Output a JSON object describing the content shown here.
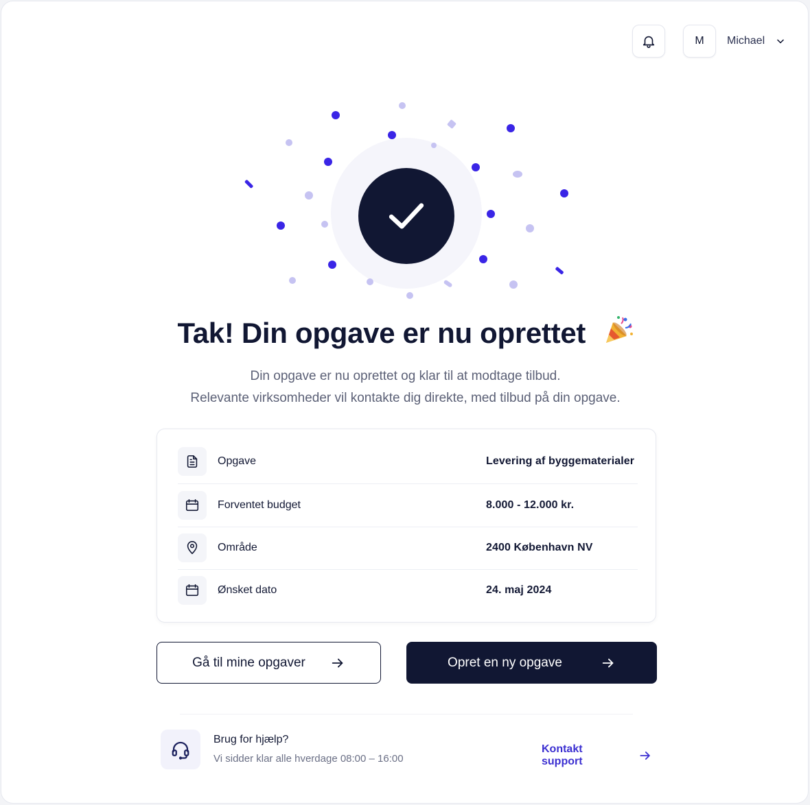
{
  "header": {
    "avatar_initial": "M",
    "user_name": "Michael"
  },
  "confirmation": {
    "title": "Tak! Din opgave er nu oprettet",
    "subtitle_line1": "Din opgave er nu oprettet og klar til at modtage tilbud.",
    "subtitle_line2": "Relevante virksomheder vil kontakte dig direkte, med tilbud på din opgave."
  },
  "summary": {
    "rows": [
      {
        "icon": "document-icon",
        "label": "Opgave",
        "value": "Levering af byggematerialer"
      },
      {
        "icon": "wallet-icon",
        "label": "Forventet budget",
        "value": "8.000 - 12.000 kr."
      },
      {
        "icon": "location-pin-icon",
        "label": "Område",
        "value": "2400 København NV"
      },
      {
        "icon": "calendar-icon",
        "label": "Ønsket dato",
        "value": "24. maj 2024"
      }
    ]
  },
  "actions": {
    "secondary_label": "Gå til mine opgaver",
    "primary_label": "Opret en ny opgave"
  },
  "help": {
    "title": "Brug for hjælp?",
    "subtitle": "Vi sidder klar alle hverdage 08:00 – 16:00",
    "link_label": "Kontakt support"
  },
  "colors": {
    "navy": "#111733",
    "accent": "#3b2fd1",
    "confetti_dark": "#3a25e6",
    "confetti_light": "#c6c3f2"
  }
}
